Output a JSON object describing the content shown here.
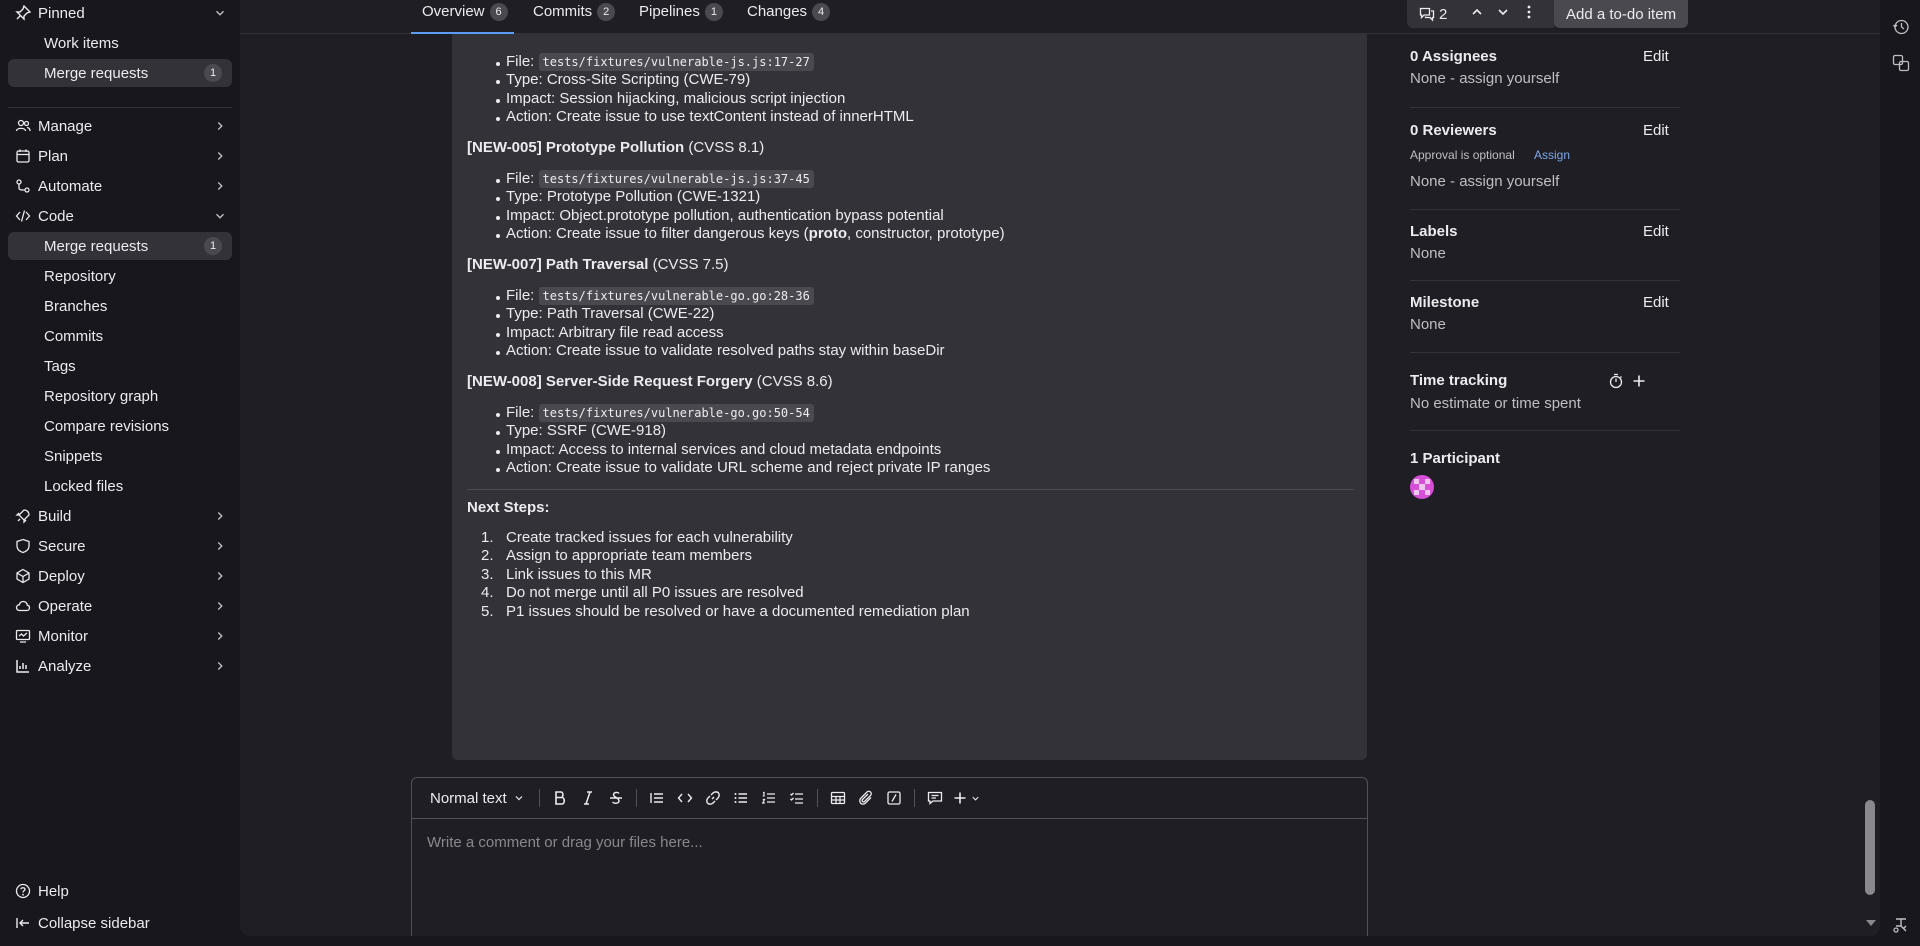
{
  "sidebar": {
    "pinned": {
      "label": "Pinned"
    },
    "pinned_items": [
      {
        "label": "Work items"
      },
      {
        "label": "Merge requests",
        "count": "1"
      }
    ],
    "groups": [
      {
        "label": "Manage",
        "icon": "users-icon"
      },
      {
        "label": "Plan",
        "icon": "calendar-icon"
      },
      {
        "label": "Automate",
        "icon": "rocket-icon"
      },
      {
        "label": "Code",
        "icon": "code-icon"
      }
    ],
    "code_items": [
      {
        "label": "Merge requests",
        "count": "1"
      },
      {
        "label": "Repository"
      },
      {
        "label": "Branches"
      },
      {
        "label": "Commits"
      },
      {
        "label": "Tags"
      },
      {
        "label": "Repository graph"
      },
      {
        "label": "Compare revisions"
      },
      {
        "label": "Snippets"
      },
      {
        "label": "Locked files"
      }
    ],
    "groups2": [
      {
        "label": "Build",
        "icon": "rocket-icon"
      },
      {
        "label": "Secure",
        "icon": "shield-icon"
      },
      {
        "label": "Deploy",
        "icon": "deploy-icon"
      },
      {
        "label": "Operate",
        "icon": "cloud-icon"
      },
      {
        "label": "Monitor",
        "icon": "monitor-icon"
      },
      {
        "label": "Analyze",
        "icon": "chart-icon"
      }
    ],
    "help": "Help",
    "collapse": "Collapse sidebar"
  },
  "tabs": [
    {
      "label": "Overview",
      "count": "6"
    },
    {
      "label": "Commits",
      "count": "2"
    },
    {
      "label": "Pipelines",
      "count": "1"
    },
    {
      "label": "Changes",
      "count": "4"
    }
  ],
  "toolbar": {
    "threads_count": "2",
    "todo_label": "Add a to-do item"
  },
  "comment": {
    "item0": {
      "file_label": "File: ",
      "file": "tests/fixtures/vulnerable-js.js:17-27",
      "type": "Type: Cross-Site Scripting (CWE-79)",
      "impact": "Impact: Session hijacking, malicious script injection",
      "action": "Action: Create issue to use textContent instead of innerHTML"
    },
    "item1": {
      "head_bold": "[NEW-005] Prototype Pollution",
      "head_rest": " (CVSS 8.1)",
      "file_label": "File: ",
      "file": "tests/fixtures/vulnerable-js.js:37-45",
      "type": "Type: Prototype Pollution (CWE-1321)",
      "impact": "Impact: Object.prototype pollution, authentication bypass potential",
      "action_pre": "Action: Create issue to filter dangerous keys (",
      "action_bold": "proto",
      "action_post": ", constructor, prototype)"
    },
    "item2": {
      "head_bold": "[NEW-007] Path Traversal",
      "head_rest": " (CVSS 7.5)",
      "file_label": "File: ",
      "file": "tests/fixtures/vulnerable-go.go:28-36",
      "type": "Type: Path Traversal (CWE-22)",
      "impact": "Impact: Arbitrary file read access",
      "action": "Action: Create issue to validate resolved paths stay within baseDir"
    },
    "item3": {
      "head_bold": "[NEW-008] Server-Side Request Forgery",
      "head_rest": " (CVSS 8.6)",
      "file_label": "File: ",
      "file": "tests/fixtures/vulnerable-go.go:50-54",
      "type": "Type: SSRF (CWE-918)",
      "impact": "Impact: Access to internal services and cloud metadata endpoints",
      "action": "Action: Create issue to validate URL scheme and reject private IP ranges"
    },
    "next_steps_title": "Next Steps:",
    "next_steps": [
      "Create tracked issues for each vulnerability",
      "Assign to appropriate team members",
      "Link issues to this MR",
      "Do not merge until all P0 issues are resolved",
      "P1 issues should be resolved or have a documented remediation plan"
    ]
  },
  "editor": {
    "format_label": "Normal text",
    "placeholder": "Write a comment or drag your files here..."
  },
  "right_sidebar": {
    "assignees_title": "0 Assignees",
    "assignees_value": "None - assign yourself",
    "reviewers_title": "0 Reviewers",
    "approval_text": "Approval is optional",
    "assign_link": "Assign",
    "reviewers_value": "None - assign yourself",
    "labels_title": "Labels",
    "labels_value": "None",
    "milestone_title": "Milestone",
    "milestone_value": "None",
    "time_title": "Time tracking",
    "time_value": "No estimate or time spent",
    "participants_title": "1 Participant",
    "edit_label": "Edit"
  },
  "colors": {
    "accent": "#5d9cf3",
    "link": "#7ea7e8",
    "avatar": "#d64fd6"
  }
}
